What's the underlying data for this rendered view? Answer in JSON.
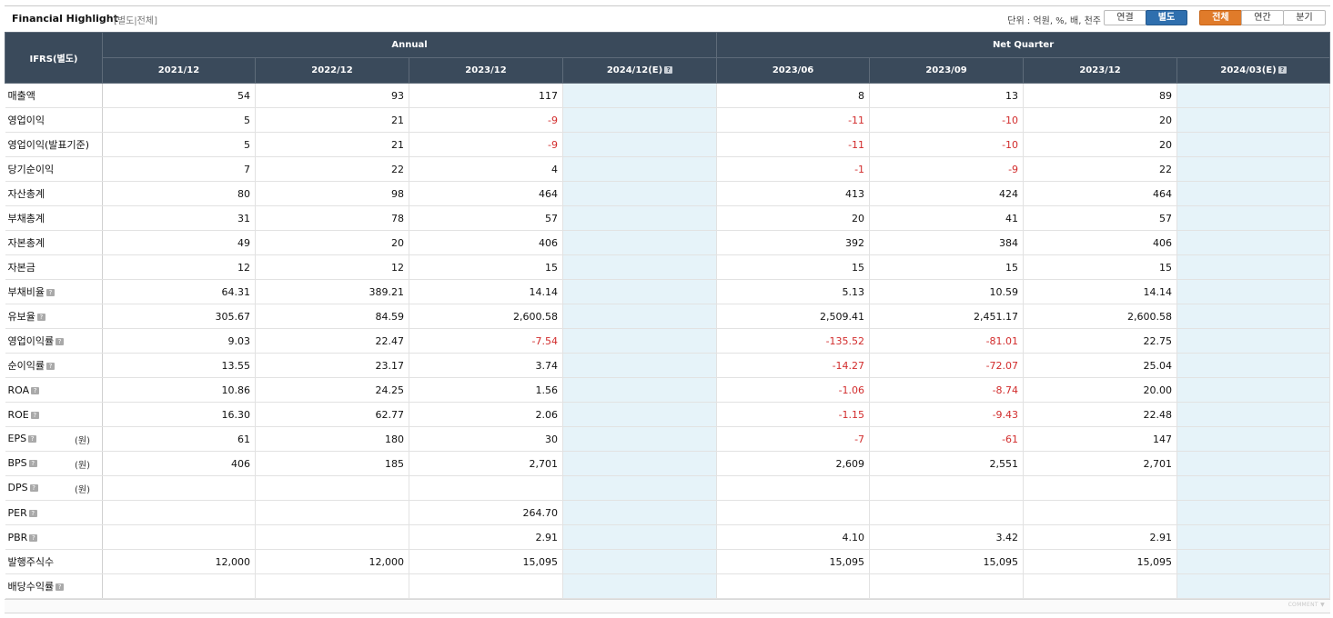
{
  "header": {
    "title": "Financial Highlight",
    "subtitle": "[별도|전체]",
    "unit": "단위 : 억원, %, 배, 천주",
    "basis_buttons": [
      "연결",
      "별도"
    ],
    "period_buttons": [
      "전체",
      "연간",
      "분기"
    ]
  },
  "table": {
    "corner_label": "IFRS(별도)",
    "group_annual": "Annual",
    "group_quarter": "Net Quarter",
    "periods": [
      "2021/12",
      "2022/12",
      "2023/12",
      "2024/12(E)",
      "2023/06",
      "2023/09",
      "2023/12",
      "2024/03(E)"
    ],
    "rows": [
      {
        "label": "매출액",
        "help": false,
        "unit": "",
        "values": [
          "54",
          "93",
          "117",
          "",
          "8",
          "13",
          "89",
          ""
        ]
      },
      {
        "label": "영업이익",
        "help": false,
        "unit": "",
        "values": [
          "5",
          "21",
          "-9",
          "",
          "-11",
          "-10",
          "20",
          ""
        ]
      },
      {
        "label": "영업이익(발표기준)",
        "help": false,
        "unit": "",
        "values": [
          "5",
          "21",
          "-9",
          "",
          "-11",
          "-10",
          "20",
          ""
        ]
      },
      {
        "label": "당기순이익",
        "help": false,
        "unit": "",
        "values": [
          "7",
          "22",
          "4",
          "",
          "-1",
          "-9",
          "22",
          ""
        ]
      },
      {
        "label": "자산총계",
        "help": false,
        "unit": "",
        "values": [
          "80",
          "98",
          "464",
          "",
          "413",
          "424",
          "464",
          ""
        ]
      },
      {
        "label": "부채총계",
        "help": false,
        "unit": "",
        "values": [
          "31",
          "78",
          "57",
          "",
          "20",
          "41",
          "57",
          ""
        ]
      },
      {
        "label": "자본총계",
        "help": false,
        "unit": "",
        "values": [
          "49",
          "20",
          "406",
          "",
          "392",
          "384",
          "406",
          ""
        ]
      },
      {
        "label": "자본금",
        "help": false,
        "unit": "",
        "values": [
          "12",
          "12",
          "15",
          "",
          "15",
          "15",
          "15",
          ""
        ]
      },
      {
        "label": "부채비율",
        "help": true,
        "unit": "",
        "values": [
          "64.31",
          "389.21",
          "14.14",
          "",
          "5.13",
          "10.59",
          "14.14",
          ""
        ]
      },
      {
        "label": "유보율",
        "help": true,
        "unit": "",
        "values": [
          "305.67",
          "84.59",
          "2,600.58",
          "",
          "2,509.41",
          "2,451.17",
          "2,600.58",
          ""
        ]
      },
      {
        "label": "영업이익률",
        "help": true,
        "unit": "",
        "values": [
          "9.03",
          "22.47",
          "-7.54",
          "",
          "-135.52",
          "-81.01",
          "22.75",
          ""
        ]
      },
      {
        "label": "순이익률",
        "help": true,
        "unit": "",
        "values": [
          "13.55",
          "23.17",
          "3.74",
          "",
          "-14.27",
          "-72.07",
          "25.04",
          ""
        ]
      },
      {
        "label": "ROA",
        "help": true,
        "unit": "",
        "values": [
          "10.86",
          "24.25",
          "1.56",
          "",
          "-1.06",
          "-8.74",
          "20.00",
          ""
        ]
      },
      {
        "label": "ROE",
        "help": true,
        "unit": "",
        "values": [
          "16.30",
          "62.77",
          "2.06",
          "",
          "-1.15",
          "-9.43",
          "22.48",
          ""
        ]
      },
      {
        "label": "EPS",
        "help": true,
        "unit": "(원)",
        "values": [
          "61",
          "180",
          "30",
          "",
          "-7",
          "-61",
          "147",
          ""
        ]
      },
      {
        "label": "BPS",
        "help": true,
        "unit": "(원)",
        "values": [
          "406",
          "185",
          "2,701",
          "",
          "2,609",
          "2,551",
          "2,701",
          ""
        ]
      },
      {
        "label": "DPS",
        "help": true,
        "unit": "(원)",
        "values": [
          "",
          "",
          "",
          "",
          "",
          "",
          "",
          ""
        ]
      },
      {
        "label": "PER",
        "help": true,
        "unit": "",
        "values": [
          "",
          "",
          "264.70",
          "",
          "",
          "",
          "",
          ""
        ]
      },
      {
        "label": "PBR",
        "help": true,
        "unit": "",
        "values": [
          "",
          "",
          "2.91",
          "",
          "4.10",
          "3.42",
          "2.91",
          ""
        ]
      },
      {
        "label": "발행주식수",
        "help": false,
        "unit": "",
        "values": [
          "12,000",
          "12,000",
          "15,095",
          "",
          "15,095",
          "15,095",
          "15,095",
          ""
        ]
      },
      {
        "label": "배당수익률",
        "help": true,
        "unit": "",
        "values": [
          "",
          "",
          "",
          "",
          "",
          "",
          "",
          ""
        ]
      }
    ]
  },
  "footer": {
    "comment": "COMMENT ▼"
  },
  "colors": {
    "header_bg": "#3a4a5b",
    "estimate_bg": "#e6f3f9",
    "negative": "#d22c2c",
    "active_blue": "#2f6fae",
    "active_orange": "#e07b2a"
  }
}
